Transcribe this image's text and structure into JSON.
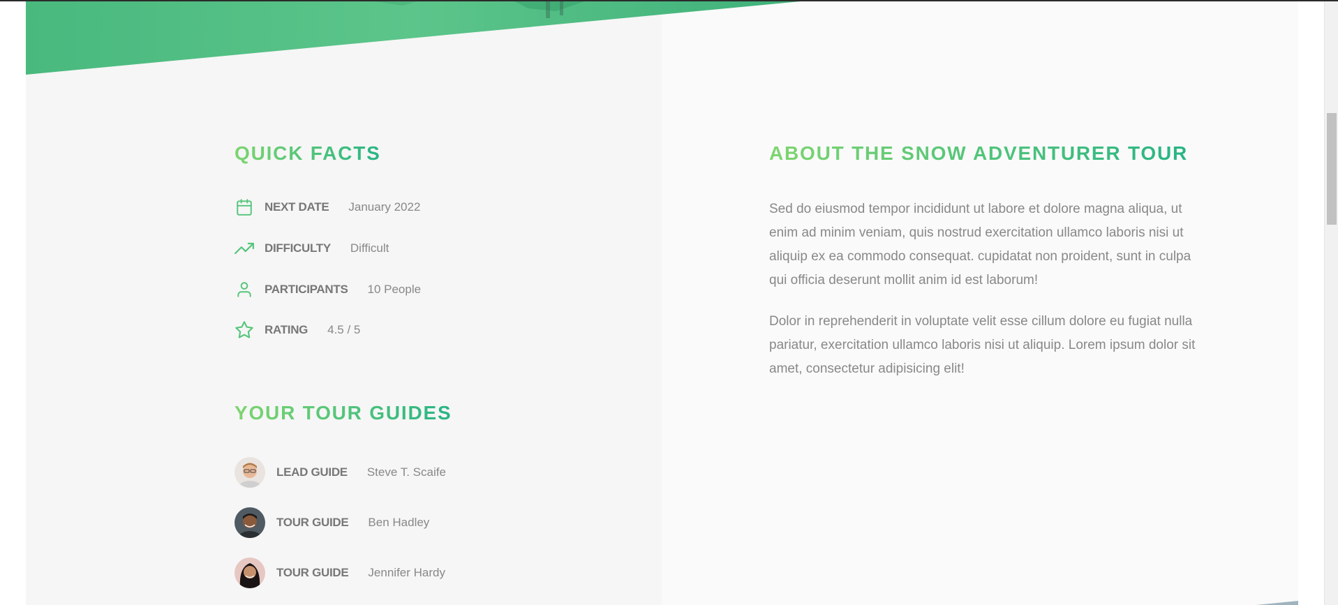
{
  "colors": {
    "accent_light": "#7ed56f",
    "accent_dark": "#28b485",
    "text_label": "#777777",
    "text_value": "#888888"
  },
  "quick_facts": {
    "title": "Quick Facts",
    "items": [
      {
        "icon": "calendar-icon",
        "label": "NEXT DATE",
        "value": "January 2022"
      },
      {
        "icon": "trending-up-icon",
        "label": "DIFFICULTY",
        "value": "Difficult"
      },
      {
        "icon": "user-icon",
        "label": "PARTICIPANTS",
        "value": "10 People"
      },
      {
        "icon": "star-icon",
        "label": "RATING",
        "value": "4.5 / 5"
      }
    ]
  },
  "guides": {
    "title": "Your tour guides",
    "items": [
      {
        "avatar": "avatar-steve",
        "label": "LEAD GUIDE",
        "value": "Steve T. Scaife"
      },
      {
        "avatar": "avatar-ben",
        "label": "TOUR GUIDE",
        "value": "Ben Hadley"
      },
      {
        "avatar": "avatar-jennifer",
        "label": "TOUR GUIDE",
        "value": "Jennifer Hardy"
      }
    ]
  },
  "about": {
    "title": "About the snow adventurer tour",
    "paragraphs": [
      "Sed do eiusmod tempor incididunt ut labore et dolore magna aliqua, ut enim ad minim veniam, quis nostrud exercitation ullamco laboris nisi ut aliquip ex ea commodo consequat. cupidatat non proident, sunt in culpa qui officia deserunt mollit anim id est laborum!",
      "Dolor in reprehenderit in voluptate velit esse cillum dolore eu fugiat nulla pariatur, exercitation ullamco laboris nisi ut aliquip. Lorem ipsum dolor sit amet, consectetur adipisicing elit!"
    ]
  }
}
